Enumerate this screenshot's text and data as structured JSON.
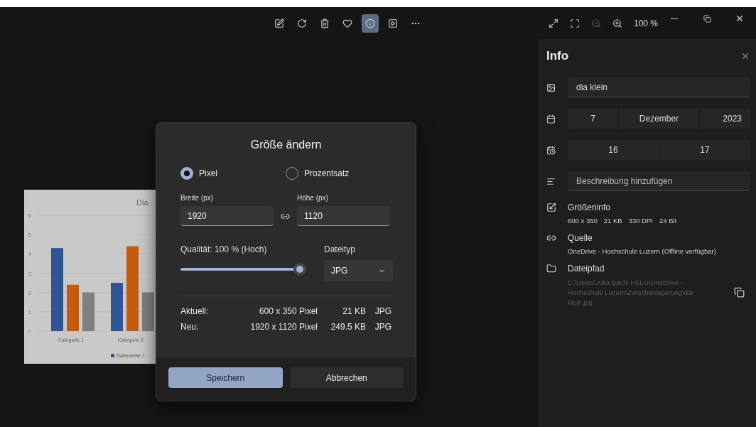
{
  "toolbar": {
    "buttons": [
      {
        "selected": false
      },
      {
        "selected": false
      },
      {
        "selected": false
      },
      {
        "selected": false
      },
      {
        "selected": true
      },
      {
        "selected": false
      },
      {
        "selected": false
      }
    ]
  },
  "view_controls": {
    "zoom_out_disabled": true,
    "zoom": "100 %"
  },
  "image": {
    "chart_data": {
      "type": "bar",
      "title": "Dia",
      "categories": [
        "Kategorie 1",
        "Kategorie 2"
      ],
      "yticks": [
        0,
        1,
        2,
        3,
        4,
        5,
        6
      ],
      "ylim": [
        0,
        6
      ],
      "grid": true,
      "series": [
        {
          "name": "Datenreihe 1",
          "color": "#2f5597",
          "values": [
            4.3,
            2.5
          ]
        },
        {
          "color": "#c55a11",
          "values": [
            2.4,
            4.4
          ]
        },
        {
          "color": "#7f7f7f",
          "values": [
            2,
            2
          ]
        }
      ]
    }
  },
  "dialog": {
    "title": "Größe ändern",
    "modes": [
      {
        "label": "Pixel",
        "selected": true
      },
      {
        "label": "Prozentsatz",
        "selected": false
      }
    ],
    "width": {
      "label": "Breite (px)",
      "value": "1920"
    },
    "height": {
      "label": "Höhe (px)",
      "value": "1120"
    },
    "quality": {
      "label": "Qualität: 100 % (Hoch)",
      "level": 1
    },
    "filetype": {
      "label": "Dateityp",
      "value": "JPG"
    },
    "rows": [
      {
        "label": "Aktuell:",
        "dimensions": "600 x 350 Pixel",
        "size": "21 KB",
        "type": "JPG"
      },
      {
        "label": "Neu:",
        "dimensions": "1920 x 1120 Pixel",
        "size": "249.5 KB",
        "type": "JPG"
      }
    ],
    "buttons": [
      {
        "label": "Speichern",
        "primary": true
      },
      {
        "label": "Abbrechen",
        "primary": false
      }
    ]
  },
  "info": {
    "title": "Info",
    "name": "dia klein",
    "date": [
      "7",
      "Dezember",
      "2023"
    ],
    "time": [
      "16",
      "17"
    ],
    "description": {
      "placeholder": "Beschreibung hinzufügen"
    },
    "sections": [
      {
        "kind": "size",
        "title": "Größeninfo",
        "details": [
          "600 x 350",
          "21 KB",
          "330 DPI",
          "24 Bit"
        ]
      },
      {
        "kind": "source",
        "title": "Quelle",
        "details": [
          "OneDrive - Hochschule Luzern (Offline verfügbar)"
        ]
      },
      {
        "kind": "path",
        "title": "Dateipfad",
        "details": [
          "C:\\Users\\Julia Bächi HSLU\\OneDrive - Hochschule Luzern\\Zwischenlagerung\\dia klein.jpg"
        ]
      }
    ]
  }
}
